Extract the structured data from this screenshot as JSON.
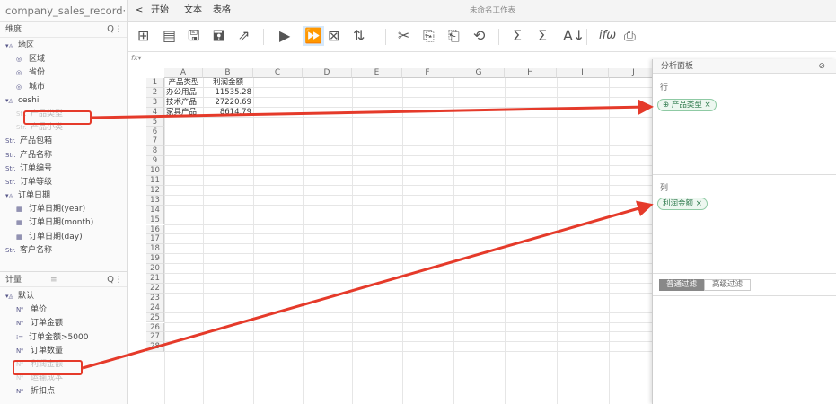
{
  "left": {
    "file_name": "company_sales_record···",
    "dim_header": "维度",
    "dim_items": [
      {
        "label": "地区",
        "icon": "folder-icon"
      },
      {
        "label": "区域",
        "icon": "geo-icon"
      },
      {
        "label": "省份",
        "icon": "geo-icon"
      },
      {
        "label": "城市",
        "icon": "geo-icon"
      },
      {
        "label": "ceshi",
        "icon": "folder-icon"
      },
      {
        "label": "产品类型",
        "icon": "str-icon"
      },
      {
        "label": "产品小类",
        "icon": "str-icon"
      },
      {
        "label": "产品包箱",
        "icon": "str-icon"
      },
      {
        "label": "产品名称",
        "icon": "str-icon"
      },
      {
        "label": "订单编号",
        "icon": "str-icon"
      },
      {
        "label": "订单等级",
        "icon": "str-icon"
      },
      {
        "label": "订单日期",
        "icon": "folder-icon"
      },
      {
        "label": "订单日期(year)",
        "icon": "calendar-icon"
      },
      {
        "label": "订单日期(month)",
        "icon": "calendar-icon"
      },
      {
        "label": "订单日期(day)",
        "icon": "calendar-icon"
      },
      {
        "label": "客户名称",
        "icon": "str-icon"
      }
    ],
    "mea_header": "计量",
    "mea_items": [
      {
        "label": "默认",
        "icon": "folder-icon"
      },
      {
        "label": "单价",
        "icon": "num-icon"
      },
      {
        "label": "订单金额",
        "icon": "num-icon"
      },
      {
        "label": "订单金额>5000",
        "icon": "calc-icon"
      },
      {
        "label": "订单数量",
        "icon": "num-icon"
      },
      {
        "label": "利润金额",
        "icon": "num-icon"
      },
      {
        "label": "运输成本",
        "icon": "num-icon"
      },
      {
        "label": "折扣点",
        "icon": "num-icon"
      }
    ],
    "str_tag": "Str.",
    "num_tag": "N⁰"
  },
  "tabs": {
    "back": "<",
    "start": "开始",
    "text": "文本",
    "table": "表格",
    "doc_title": "未命名工作表"
  },
  "toolbar": [
    "⊞",
    "▤",
    "🖫",
    "🖬",
    "⇗",
    "▶",
    "⏩",
    "⊠",
    "⇅",
    "✂",
    "⎘",
    "⎗",
    "⟲",
    "Σ",
    "Σ",
    "A↓",
    "ifω",
    "⎙"
  ],
  "fx": "fx▾",
  "columns": [
    "A",
    "B",
    "C",
    "D",
    "E",
    "F",
    "G",
    "H",
    "I",
    "J"
  ],
  "rows": [
    "1",
    "2",
    "3",
    "4",
    "5",
    "6",
    "7",
    "8",
    "9",
    "10",
    "11",
    "12",
    "13",
    "14",
    "15",
    "16",
    "17",
    "18",
    "19",
    "20",
    "21",
    "22",
    "23",
    "24",
    "25",
    "26",
    "27",
    "28"
  ],
  "cells": [
    [
      "产品类型",
      "利润金额"
    ],
    [
      "办公用品",
      "11535.28"
    ],
    [
      "技术产品",
      "27220.69"
    ],
    [
      "家具产品",
      "8614.79"
    ]
  ],
  "panel": {
    "title": "分析面板",
    "rows_label": "行",
    "cols_label": "列",
    "row_chip": "产品类型 ×",
    "col_chip": "利润金额 ×",
    "filter_tabs": [
      "普通过滤",
      "高级过滤"
    ]
  },
  "colors": {
    "arrow": "#e53a2a",
    "accent": "#1b76d2",
    "chip": "#2f7a4d"
  }
}
